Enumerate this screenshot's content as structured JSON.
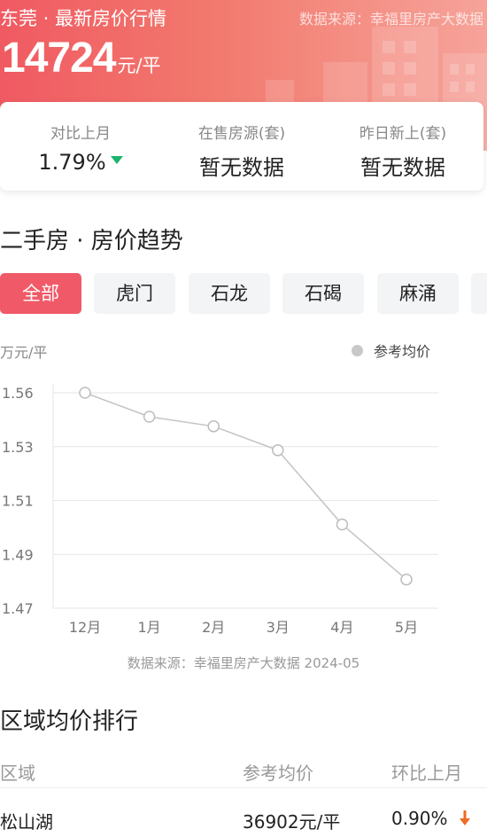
{
  "header": {
    "title": "东莞 · 最新房价行情",
    "source": "数据来源：幸福里房产大数据",
    "price": "14724",
    "price_unit": "元/平",
    "colors": {
      "gradient_start": "#f05a62",
      "gradient_end": "#f6a39a"
    }
  },
  "stats": [
    {
      "label": "对比上月",
      "value": "1.79%",
      "trend": "down",
      "trend_color": "#19b66b"
    },
    {
      "label": "在售房源(套)",
      "value": "暂无数据"
    },
    {
      "label": "昨日新上(套)",
      "value": "暂无数据"
    }
  ],
  "trend_section": {
    "title": "二手房 · 房价趋势",
    "tabs": [
      "全部",
      "虎门",
      "石龙",
      "石碣",
      "麻涌"
    ],
    "active_tab": "全部",
    "accent_color": "#f05a68"
  },
  "chart_data": {
    "type": "line",
    "ylabel": "万元/平",
    "categories": [
      "12月",
      "1月",
      "2月",
      "3月",
      "4月",
      "5月"
    ],
    "series": [
      {
        "name": "参考均价",
        "values": [
          1.56,
          1.55,
          1.546,
          1.536,
          1.505,
          1.482
        ]
      }
    ],
    "yticks": [
      "1.56",
      "1.53",
      "1.51",
      "1.49",
      "1.47"
    ],
    "ylim": [
      1.47,
      1.56
    ],
    "grid": true,
    "legend_position": "top-right",
    "source": "数据来源：幸福里房产大数据 2024-05"
  },
  "ranking": {
    "title": "区域均价排行",
    "columns": [
      "区域",
      "参考均价",
      "环比上月"
    ],
    "rows": [
      {
        "area": "松山湖",
        "price": "36902元/平",
        "change": "0.90%",
        "trend": "down",
        "trend_color": "#f06a23"
      }
    ]
  }
}
